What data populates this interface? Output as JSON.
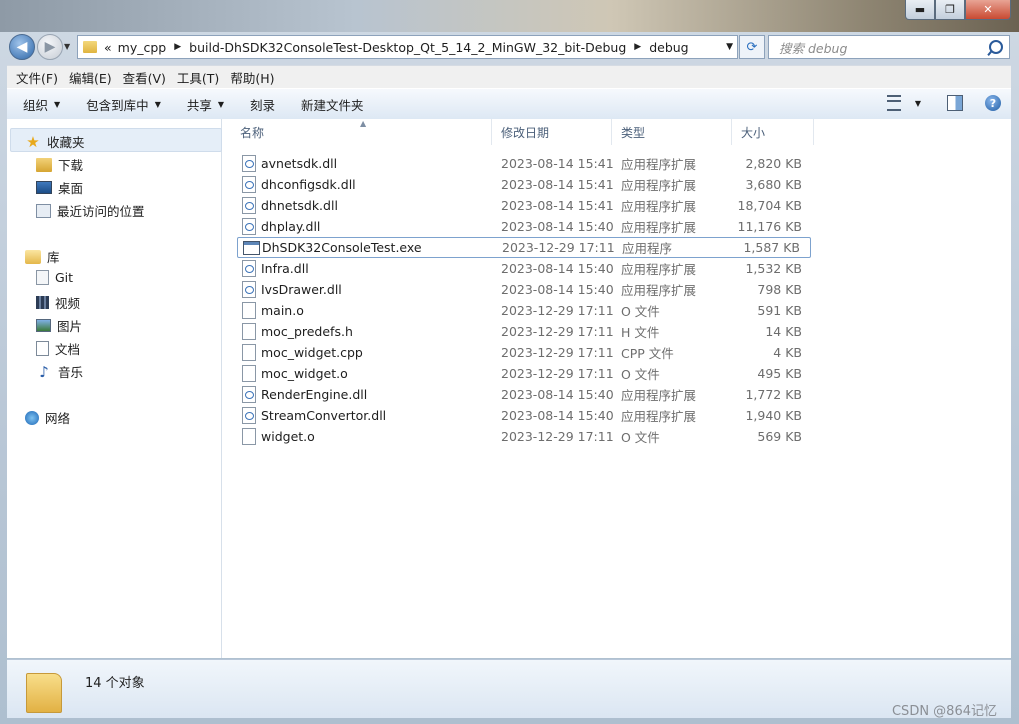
{
  "window": {
    "controls": {
      "minimize": "▬",
      "maximize": "❐",
      "close": "✕"
    }
  },
  "address": {
    "overflow": "«",
    "crumbs": [
      "my_cpp",
      "build-DhSDK32ConsoleTest-Desktop_Qt_5_14_2_MinGW_32_bit-Debug",
      "debug"
    ],
    "search_placeholder": "搜索 debug"
  },
  "menu": [
    "文件(F)",
    "编辑(E)",
    "查看(V)",
    "工具(T)",
    "帮助(H)"
  ],
  "toolbar": {
    "organize": "组织",
    "include_in_library": "包含到库中",
    "share": "共享",
    "burn": "刻录",
    "new_folder": "新建文件夹",
    "help_glyph": "?"
  },
  "nav": {
    "favorites": "收藏夹",
    "downloads": "下载",
    "desktop": "桌面",
    "recent": "最近访问的位置",
    "libraries": "库",
    "git": "Git",
    "videos": "视频",
    "pictures": "图片",
    "documents": "文档",
    "music": "音乐",
    "network": "网络"
  },
  "columns": {
    "name": "名称",
    "date": "修改日期",
    "type": "类型",
    "size": "大小"
  },
  "files": [
    {
      "name": "avnetsdk.dll",
      "date": "2023-08-14 15:41",
      "type": "应用程序扩展",
      "size": "2,820 KB",
      "icon": "dll-icon"
    },
    {
      "name": "dhconfigsdk.dll",
      "date": "2023-08-14 15:41",
      "type": "应用程序扩展",
      "size": "3,680 KB",
      "icon": "dll-icon"
    },
    {
      "name": "dhnetsdk.dll",
      "date": "2023-08-14 15:41",
      "type": "应用程序扩展",
      "size": "18,704 KB",
      "icon": "dll-icon"
    },
    {
      "name": "dhplay.dll",
      "date": "2023-08-14 15:40",
      "type": "应用程序扩展",
      "size": "11,176 KB",
      "icon": "dll-icon"
    },
    {
      "name": "DhSDK32ConsoleTest.exe",
      "date": "2023-12-29 17:11",
      "type": "应用程序",
      "size": "1,587 KB",
      "icon": "exe-icon"
    },
    {
      "name": "Infra.dll",
      "date": "2023-08-14 15:40",
      "type": "应用程序扩展",
      "size": "1,532 KB",
      "icon": "dll-icon"
    },
    {
      "name": "IvsDrawer.dll",
      "date": "2023-08-14 15:40",
      "type": "应用程序扩展",
      "size": "798 KB",
      "icon": "dll-icon"
    },
    {
      "name": "main.o",
      "date": "2023-12-29 17:11",
      "type": "O 文件",
      "size": "591 KB",
      "icon": "file-icon"
    },
    {
      "name": "moc_predefs.h",
      "date": "2023-12-29 17:11",
      "type": "H 文件",
      "size": "14 KB",
      "icon": "file-icon"
    },
    {
      "name": "moc_widget.cpp",
      "date": "2023-12-29 17:11",
      "type": "CPP 文件",
      "size": "4 KB",
      "icon": "file-icon"
    },
    {
      "name": "moc_widget.o",
      "date": "2023-12-29 17:11",
      "type": "O 文件",
      "size": "495 KB",
      "icon": "file-icon"
    },
    {
      "name": "RenderEngine.dll",
      "date": "2023-08-14 15:40",
      "type": "应用程序扩展",
      "size": "1,772 KB",
      "icon": "dll-icon"
    },
    {
      "name": "StreamConvertor.dll",
      "date": "2023-08-14 15:40",
      "type": "应用程序扩展",
      "size": "1,940 KB",
      "icon": "dll-icon"
    },
    {
      "name": "widget.o",
      "date": "2023-12-29 17:11",
      "type": "O 文件",
      "size": "569 KB",
      "icon": "file-icon"
    }
  ],
  "status": {
    "count": "14 个对象"
  },
  "watermark": "CSDN @864记忆"
}
